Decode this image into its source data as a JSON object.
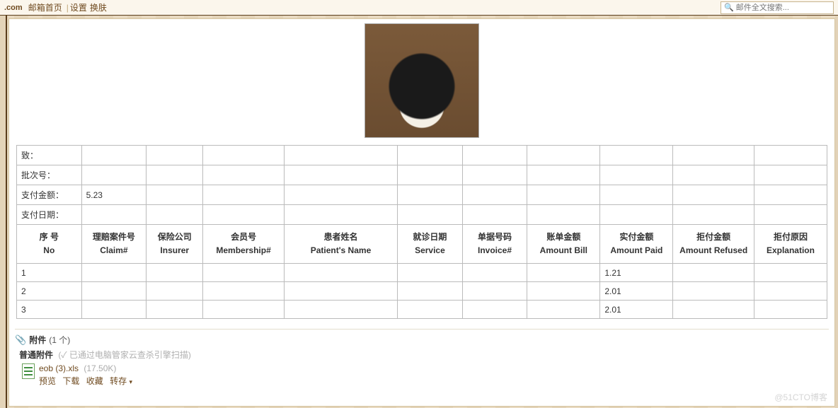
{
  "topbar": {
    "logo": ".com",
    "links": {
      "home": "邮箱首页",
      "settings": "设置",
      "skin": "换肤"
    },
    "search_placeholder": "邮件全文搜索..."
  },
  "summary_rows": {
    "to": {
      "label": "致：",
      "v1": "",
      "v2": "",
      "v3": "",
      "v4": "",
      "v5": "",
      "v6": "",
      "v7": "",
      "v8": "",
      "v9": "",
      "v10": ""
    },
    "batch": {
      "label": "批次号：",
      "v1": "",
      "v2": "",
      "v3": "",
      "v4": "",
      "v5": "",
      "v6": "",
      "v7": "",
      "v8": "",
      "v9": "",
      "v10": ""
    },
    "pay_amt": {
      "label": "支付金额：",
      "v1": "5.23",
      "v2": "",
      "v3": "",
      "v4": "",
      "v5": "",
      "v6": "",
      "v7": "",
      "v8": "",
      "v9": "",
      "v10": ""
    },
    "pay_date": {
      "label": "支付日期：",
      "v1": "",
      "v2": "",
      "v3": "",
      "v4": "",
      "v5": "",
      "v6": "",
      "v7": "",
      "v8": "",
      "v9": "",
      "v10": ""
    }
  },
  "columns": [
    {
      "zh": "序 号",
      "en": "No"
    },
    {
      "zh": "理赔案件号",
      "en": "Claim#"
    },
    {
      "zh": "保险公司",
      "en": "Insurer"
    },
    {
      "zh": "会员号",
      "en": "Membership#"
    },
    {
      "zh": "患者姓名",
      "en": "Patient's Name"
    },
    {
      "zh": "就诊日期",
      "en": "Service"
    },
    {
      "zh": "单据号码",
      "en": "Invoice#"
    },
    {
      "zh": "账单金额",
      "en": "Amount Bill"
    },
    {
      "zh": "实付金额",
      "en": "Amount Paid"
    },
    {
      "zh": "拒付金额",
      "en": "Amount Refused"
    },
    {
      "zh": "拒付原因",
      "en": "Explanation"
    }
  ],
  "rows": [
    {
      "no": "1",
      "claim": "",
      "insurer": "",
      "membership": "",
      "patient": "",
      "service": "",
      "invoice": "",
      "bill": "",
      "paid": "1.21",
      "refused": "",
      "explanation": ""
    },
    {
      "no": "2",
      "claim": "",
      "insurer": "",
      "membership": "",
      "patient": "",
      "service": "",
      "invoice": "",
      "bill": "",
      "paid": "2.01",
      "refused": "",
      "explanation": ""
    },
    {
      "no": "3",
      "claim": "",
      "insurer": "",
      "membership": "",
      "patient": "",
      "service": "",
      "invoice": "",
      "bill": "",
      "paid": "2.01",
      "refused": "",
      "explanation": ""
    }
  ],
  "attachments": {
    "title": "附件",
    "count_text": "(1 个)",
    "normal_label": "普通附件",
    "scan_note": "(✓ 已通过电脑管家云查杀引擎扫描)",
    "file": {
      "name": "eob (3).xls",
      "size": "(17.50K)"
    },
    "actions": {
      "preview": "预览",
      "download": "下载",
      "favorite": "收藏",
      "transfer": "转存"
    }
  },
  "watermark": "@51CTO博客"
}
